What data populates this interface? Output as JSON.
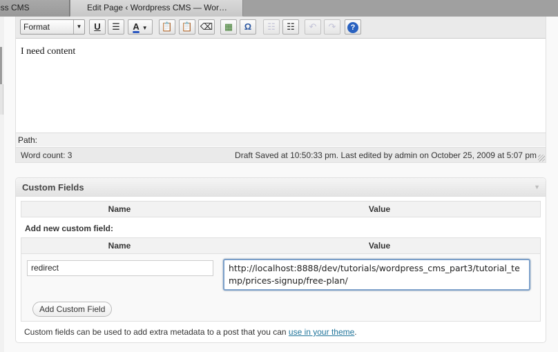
{
  "browser": {
    "tabs": [
      {
        "label": "ress CMS",
        "active": false
      },
      {
        "label": "Edit Page ‹ Wordpress CMS — Wor…",
        "active": true
      }
    ]
  },
  "editor": {
    "toolbar": {
      "format_select": "Format",
      "buttons": [
        "underline-icon",
        "justify-icon",
        "text-color-icon",
        "paste-text-icon",
        "paste-word-icon",
        "remove-format-icon",
        "media-icon",
        "special-char-icon",
        "outdent-icon",
        "indent-icon",
        "undo-icon",
        "redo-icon",
        "help-icon"
      ],
      "underline_glyph": "U",
      "omega_glyph": "Ω",
      "color_glyph": "A",
      "help_glyph": "?"
    },
    "content": "I need content",
    "path_label": "Path:",
    "word_count": "Word count: 3",
    "draft_status": "Draft Saved at 10:50:33 pm. Last edited by admin on October 25, 2009 at 5:07 pm"
  },
  "custom_fields": {
    "title": "Custom Fields",
    "columns": {
      "name": "Name",
      "value": "Value"
    },
    "add_new_label": "Add new custom field:",
    "new_name_value": "redirect",
    "new_value_value": "http://localhost:8888/dev/tutorials/wordpress_cms_part3/tutorial_temp/prices-signup/free-plan/",
    "add_button": "Add Custom Field",
    "help_text": "Custom fields can be used to add extra metadata to a post that you can ",
    "help_link": "use in your theme",
    "help_suffix": "."
  }
}
